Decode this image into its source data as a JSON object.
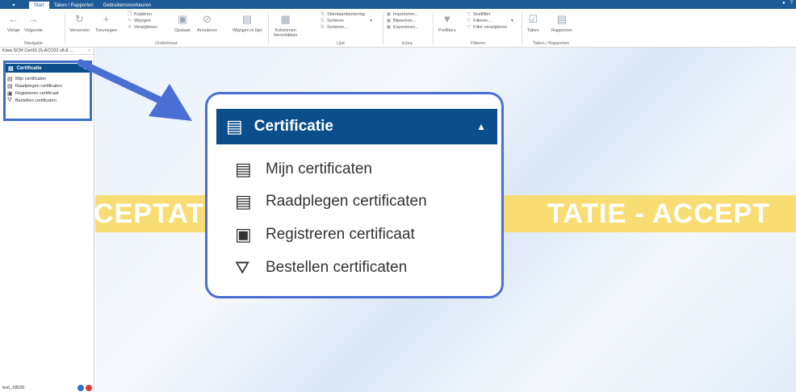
{
  "tabbar": {
    "app_menu": "▾",
    "tabs": [
      "Start",
      "Taken / Rapporten",
      "Gebruikersvoorkeuren"
    ],
    "help": "?"
  },
  "ribbon": {
    "navigatie": {
      "group": "Navigatie",
      "vorige": "Vorige",
      "volgende": "Volgende"
    },
    "onderhoud": {
      "group": "Onderhoud",
      "verversen": "Verversen",
      "toevoegen": "Toevoegen",
      "kopieren": "Kopiëren",
      "wijzigen": "Wijzigen",
      "verwijderen": "Verwijderen",
      "opslaan": "Opslaan",
      "annuleren": "Annuleren",
      "wijzigen_in_lijst": "Wijzigen in lijst"
    },
    "lijst": {
      "group": "Lijst",
      "kolommen": "Kolommen",
      "herschikken": "herschikken",
      "standaardsortering": "Standaardsortering",
      "sorteren": "Sorteren",
      "sorteren_dots": "Sorteren..."
    },
    "extra": {
      "group": "Extra",
      "importeren": "Importeren...",
      "bijwerken": "Bijwerken...",
      "exporteren": "Exporteren..."
    },
    "filteren": {
      "group": "Filteren",
      "prefilters": "Prefilters",
      "snelfilter": "Snelfilter",
      "filteren": "Filteren...",
      "filter_verwijderen": "Filter verwijderen"
    },
    "taken": {
      "group": "Taken / Rapporten",
      "taken": "Taken",
      "rapporten": "Rapporten"
    }
  },
  "navpane": {
    "header": "Kiwa SCM CertIS (S-ACC02 v8.8....",
    "pin": "↑",
    "category": "Certificatie",
    "items": [
      "Mijn certificaten",
      "Raadplegen certificaten",
      "Registreren certificaat",
      "Bestellen certificaten"
    ],
    "status": "test_18529"
  },
  "background": {
    "banner_left": "CEPTATI",
    "banner_right": "TATIE - ACCEPT"
  },
  "callout": {
    "category": "Certificatie",
    "items": [
      "Mijn certificaten",
      "Raadplegen certificaten",
      "Registreren certificaat",
      "Bestellen certificaten"
    ]
  },
  "colors": {
    "brand": "#1f5a98",
    "nav_header": "#0a4e8b",
    "highlight": "#3d6fc7",
    "banner": "#f8dd74"
  }
}
